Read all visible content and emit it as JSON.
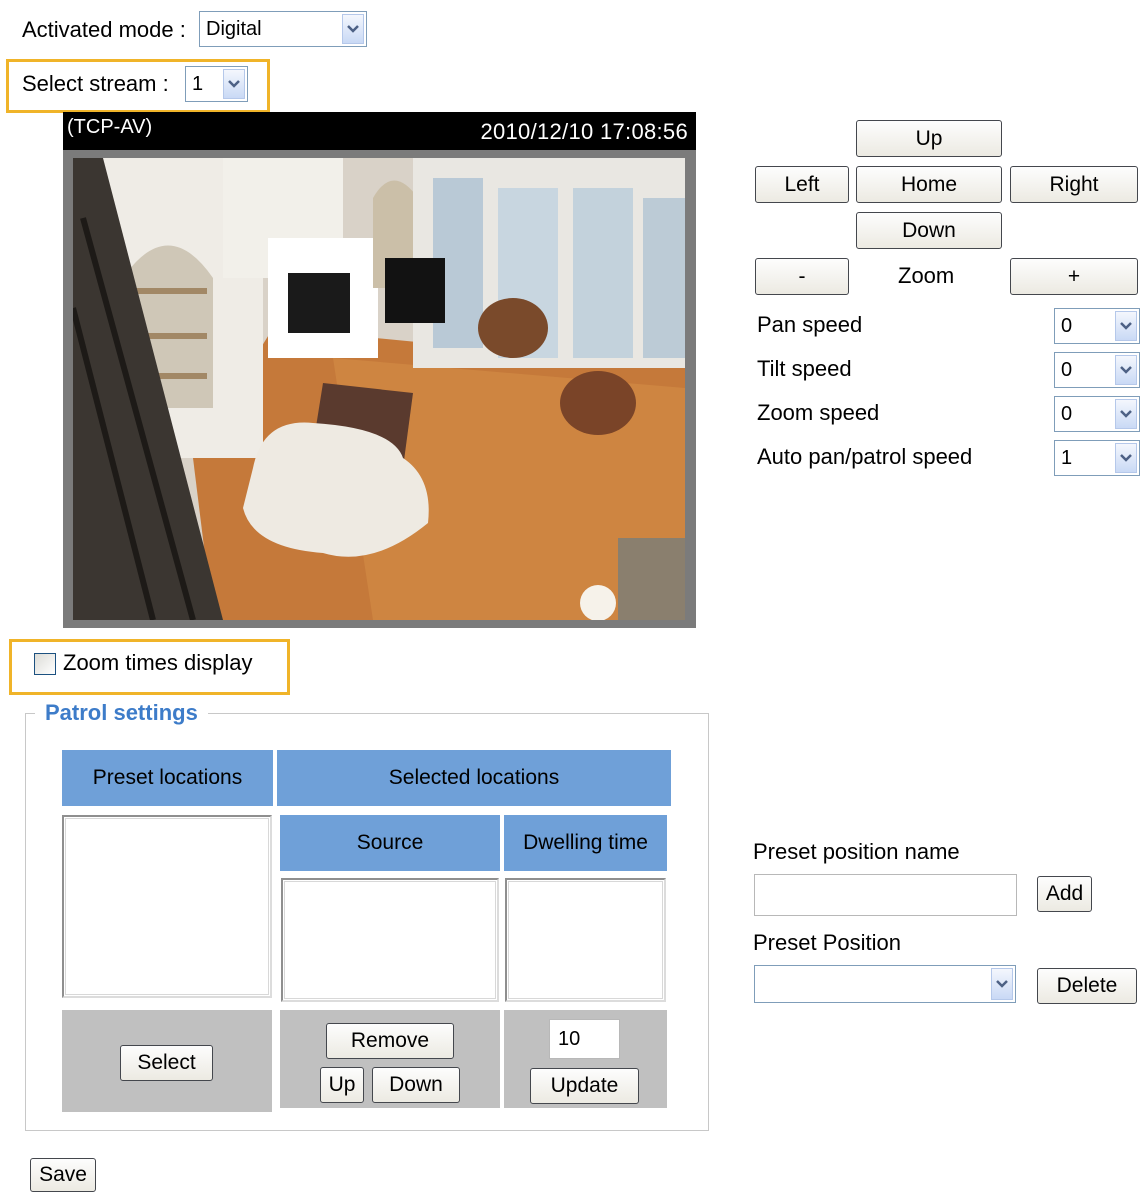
{
  "activated_mode": {
    "label": "Activated mode :",
    "value": "Digital"
  },
  "stream": {
    "label": "Select stream :",
    "value": "1"
  },
  "video": {
    "protocol": "(TCP-AV)",
    "timestamp": "2010/12/10  17:08:56"
  },
  "ptz": {
    "up": "Up",
    "left": "Left",
    "home": "Home",
    "right": "Right",
    "down": "Down",
    "zoom_out": "-",
    "zoom_label": "Zoom",
    "zoom_in": "+"
  },
  "speeds": [
    {
      "label": "Pan speed",
      "value": "0"
    },
    {
      "label": "Tilt speed",
      "value": "0"
    },
    {
      "label": "Zoom speed",
      "value": "0"
    },
    {
      "label": "Auto pan/patrol speed",
      "value": "1"
    }
  ],
  "zoom_display": {
    "label": "Zoom times display",
    "checked": false
  },
  "patrol": {
    "title": "Patrol settings",
    "preset_locations": "Preset locations",
    "selected_locations": "Selected locations",
    "source": "Source",
    "dwelling_time": "Dwelling time",
    "select": "Select",
    "remove": "Remove",
    "up": "Up",
    "down": "Down",
    "dwell_value": "10",
    "update": "Update"
  },
  "preset": {
    "name_label": "Preset position name",
    "name_value": "",
    "add": "Add",
    "position_label": "Preset Position",
    "position_value": "",
    "delete": "Delete"
  },
  "save": "Save",
  "colors": {
    "highlight": "#f0b429",
    "header_blue": "#6fa0d8",
    "legend_blue": "#3d7cc9"
  }
}
